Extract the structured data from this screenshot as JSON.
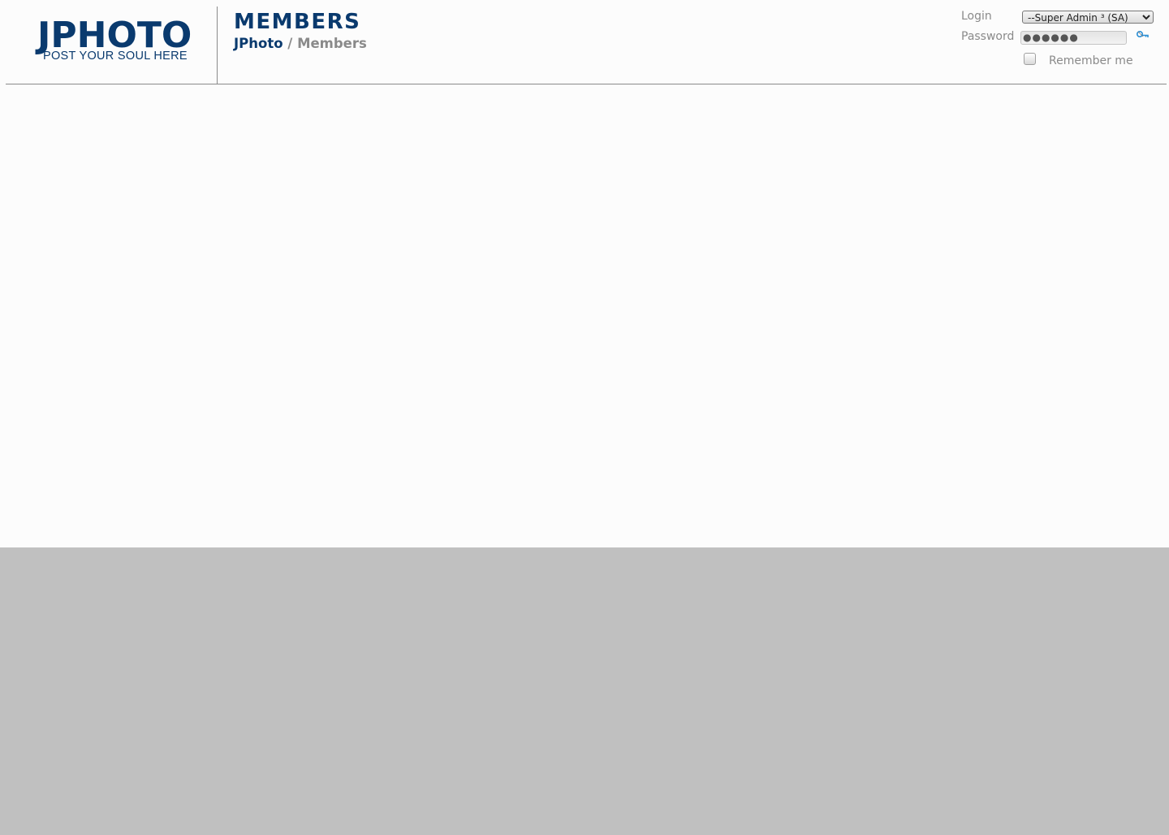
{
  "logo": {
    "title": "JPHOTO",
    "tagline": "POST YOUR SOUL HERE"
  },
  "header": {
    "page_title": "MEMBERS",
    "breadcrumb": {
      "home": "JPhoto",
      "separator": " / ",
      "current": "Members"
    }
  },
  "login": {
    "login_label": "Login",
    "password_label": "Password",
    "selected_user": "--Super Admin ³ (SA)",
    "password_mask": "●●●●●●",
    "remember_label": "Remember me",
    "remember_checked": false,
    "submit_icon": "key-icon"
  },
  "colors": {
    "brand": "#0a3a6e",
    "muted_text": "#8a8a8a",
    "page_background": "#fcfcfc",
    "outer_background": "#c0c0c0",
    "icon_accent": "#2a8fd6"
  }
}
